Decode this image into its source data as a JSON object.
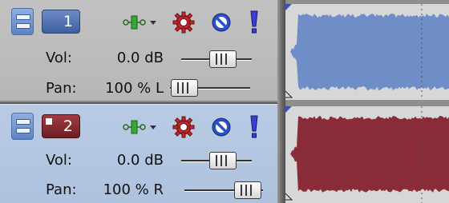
{
  "tracks": [
    {
      "number": "1",
      "vol_label": "Vol:",
      "vol_value": "0.0 dB",
      "pan_label": "Pan:",
      "pan_value": "100 % L",
      "vol_level": 0.5,
      "pan_level": 0.0,
      "waveform_color": "#6f8ec8",
      "header_color": "#bcbcbc"
    },
    {
      "number": "2",
      "vol_label": "Vol:",
      "vol_value": "0.0 dB",
      "pan_label": "Pan:",
      "pan_value": "100 % R",
      "vol_level": 0.5,
      "pan_level": 1.0,
      "waveform_color": "#8a2b38",
      "header_color": "#b4c6e0"
    }
  ],
  "icons": {
    "fx": "fx-chain-icon",
    "gear": "track-fx-gear-icon",
    "mute": "mute-icon",
    "solo": "solo-icon",
    "handle": "track-handle-icon"
  }
}
